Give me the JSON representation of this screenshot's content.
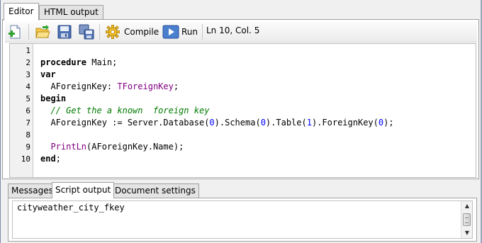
{
  "top_tabs": [
    {
      "label": "Editor",
      "active": true
    },
    {
      "label": "HTML output",
      "active": false
    }
  ],
  "toolbar": {
    "new_icon": "new-document-icon",
    "open_icon": "open-folder-icon",
    "save_icon": "save-icon",
    "save_all_icon": "save-all-icon",
    "compile_icon": "gear-icon",
    "compile_label": "Compile",
    "run_icon": "play-icon",
    "run_label": "Run",
    "cursor_position": "Ln 10, Col. 5"
  },
  "editor": {
    "line_numbers": [
      "1",
      "2",
      "3",
      "4",
      "5",
      "6",
      "7",
      "8",
      "9",
      "10"
    ],
    "lines": [
      [],
      [
        {
          "t": "procedure",
          "c": "kw"
        },
        {
          "t": " Main;",
          "c": ""
        }
      ],
      [
        {
          "t": "var",
          "c": "kw"
        }
      ],
      [
        {
          "t": "  AForeignKey: ",
          "c": ""
        },
        {
          "t": "TForeignKey",
          "c": "ty"
        },
        {
          "t": ";",
          "c": ""
        }
      ],
      [
        {
          "t": "begin",
          "c": "kw"
        }
      ],
      [
        {
          "t": "  // Get the a known  foreign key",
          "c": "cm"
        }
      ],
      [
        {
          "t": "  AForeignKey := Server.Database(",
          "c": ""
        },
        {
          "t": "0",
          "c": "num"
        },
        {
          "t": ").Schema(",
          "c": ""
        },
        {
          "t": "0",
          "c": "num"
        },
        {
          "t": ").Table(",
          "c": ""
        },
        {
          "t": "1",
          "c": "num"
        },
        {
          "t": ").ForeignKey(",
          "c": ""
        },
        {
          "t": "0",
          "c": "num"
        },
        {
          "t": ");",
          "c": ""
        }
      ],
      [],
      [
        {
          "t": "  ",
          "c": ""
        },
        {
          "t": "PrintLn",
          "c": "fn"
        },
        {
          "t": "(AForeignKey.Name);",
          "c": ""
        }
      ],
      [
        {
          "t": "end",
          "c": "kw"
        },
        {
          "t": ";",
          "c": ""
        }
      ]
    ]
  },
  "bottom_tabs": [
    {
      "label": "Messages",
      "active": false
    },
    {
      "label": "Script output",
      "active": true
    },
    {
      "label": "Document settings",
      "active": false
    }
  ],
  "output": {
    "text": "cityweather_city_fkey"
  },
  "colors": {
    "keyword": "#000000",
    "type": "#800080",
    "comment": "#007a00",
    "number": "#0000ff",
    "function": "#800080"
  }
}
